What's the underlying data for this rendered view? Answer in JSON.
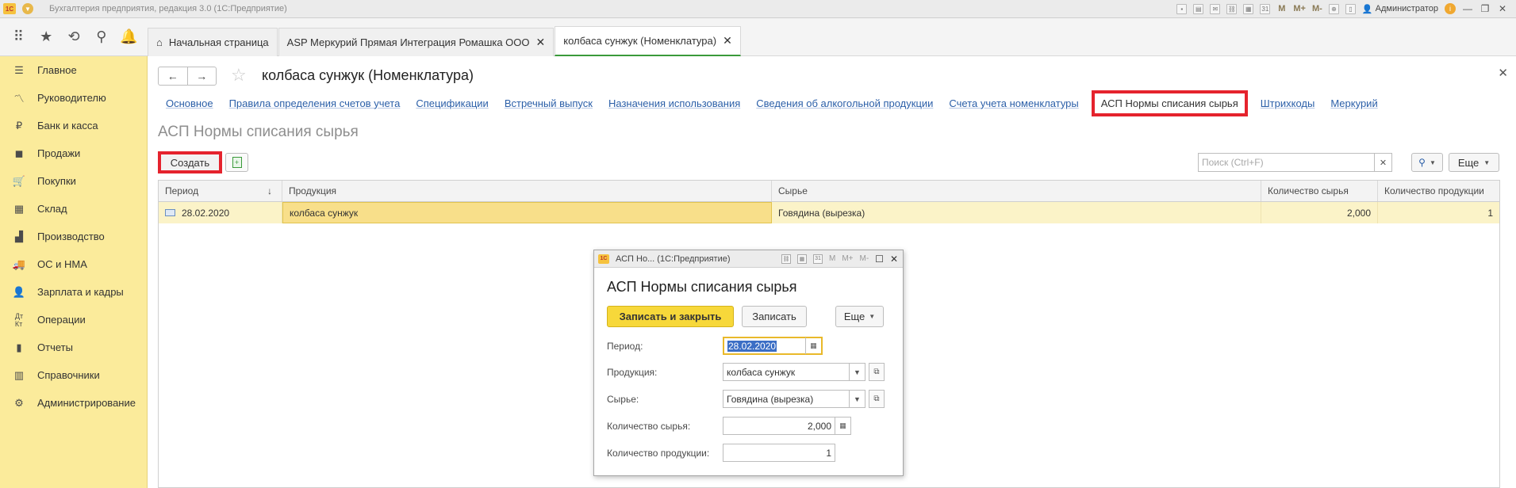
{
  "window": {
    "title": "Бухгалтерия предприятия, редакция 3.0  (1С:Предприятие)",
    "user": "Администратор",
    "tools": [
      "M",
      "M+",
      "M-"
    ]
  },
  "tabs": [
    {
      "label": "Начальная страница",
      "closable": false,
      "active": false
    },
    {
      "label": "ASP Меркурий Прямая Интеграция Ромашка ООО",
      "closable": true,
      "active": false
    },
    {
      "label": "колбаса сунжук (Номенклатура)",
      "closable": true,
      "active": true
    }
  ],
  "sidebar": {
    "items": [
      {
        "label": "Главное",
        "icon": "menu-lines-icon"
      },
      {
        "label": "Руководителю",
        "icon": "trend-icon"
      },
      {
        "label": "Банк и касса",
        "icon": "ruble-coin-icon"
      },
      {
        "label": "Продажи",
        "icon": "shopping-bag-icon"
      },
      {
        "label": "Покупки",
        "icon": "cart-icon"
      },
      {
        "label": "Склад",
        "icon": "warehouse-grid-icon"
      },
      {
        "label": "Производство",
        "icon": "factory-icon"
      },
      {
        "label": "ОС и НМА",
        "icon": "truck-icon"
      },
      {
        "label": "Зарплата и кадры",
        "icon": "person-icon"
      },
      {
        "label": "Операции",
        "icon": "debit-credit-icon"
      },
      {
        "label": "Отчеты",
        "icon": "bar-chart-icon"
      },
      {
        "label": "Справочники",
        "icon": "books-icon"
      },
      {
        "label": "Администрирование",
        "icon": "gear-icon"
      }
    ]
  },
  "document": {
    "title": "колбаса сунжук (Номенклатура)",
    "sections": [
      "Основное",
      "Правила определения счетов учета",
      "Спецификации",
      "Встречный выпуск",
      "Назначения использования",
      "Сведения об алкогольной продукции",
      "Счета учета номенклатуры",
      "АСП Нормы списания сырья",
      "Штрихкоды",
      "Меркурий"
    ],
    "active_section": "АСП Нормы списания сырья",
    "subtitle": "АСП Нормы списания сырья",
    "create_label": "Создать",
    "search_placeholder": "Поиск (Ctrl+F)",
    "more_label": "Еще"
  },
  "table": {
    "columns": [
      "Период",
      "Продукция",
      "Сырье",
      "Количество сырья",
      "Количество продукции"
    ],
    "rows": [
      [
        "28.02.2020",
        "колбаса сунжук",
        "Говядина (вырезка)",
        "2,000",
        "1"
      ]
    ]
  },
  "dialog": {
    "window_title": "АСП Но...  (1С:Предприятие)",
    "title": "АСП Нормы списания сырья",
    "save_close_label": "Записать и закрыть",
    "save_label": "Записать",
    "more_label": "Еще",
    "fields": {
      "period": {
        "label": "Период:",
        "value": "28.02.2020"
      },
      "product": {
        "label": "Продукция:",
        "value": "колбаса сунжук"
      },
      "raw": {
        "label": "Сырье:",
        "value": "Говядина (вырезка)"
      },
      "raw_qty": {
        "label": "Количество сырья:",
        "value": "2,000"
      },
      "prod_qty": {
        "label": "Количество продукции:",
        "value": "1"
      }
    }
  },
  "colors": {
    "sidebar_bg": "#fbeb9b",
    "accent_red": "#e5232d",
    "link": "#2b5fa8",
    "primary_button": "#f7d83a",
    "selected_row": "#fbf3c8"
  }
}
